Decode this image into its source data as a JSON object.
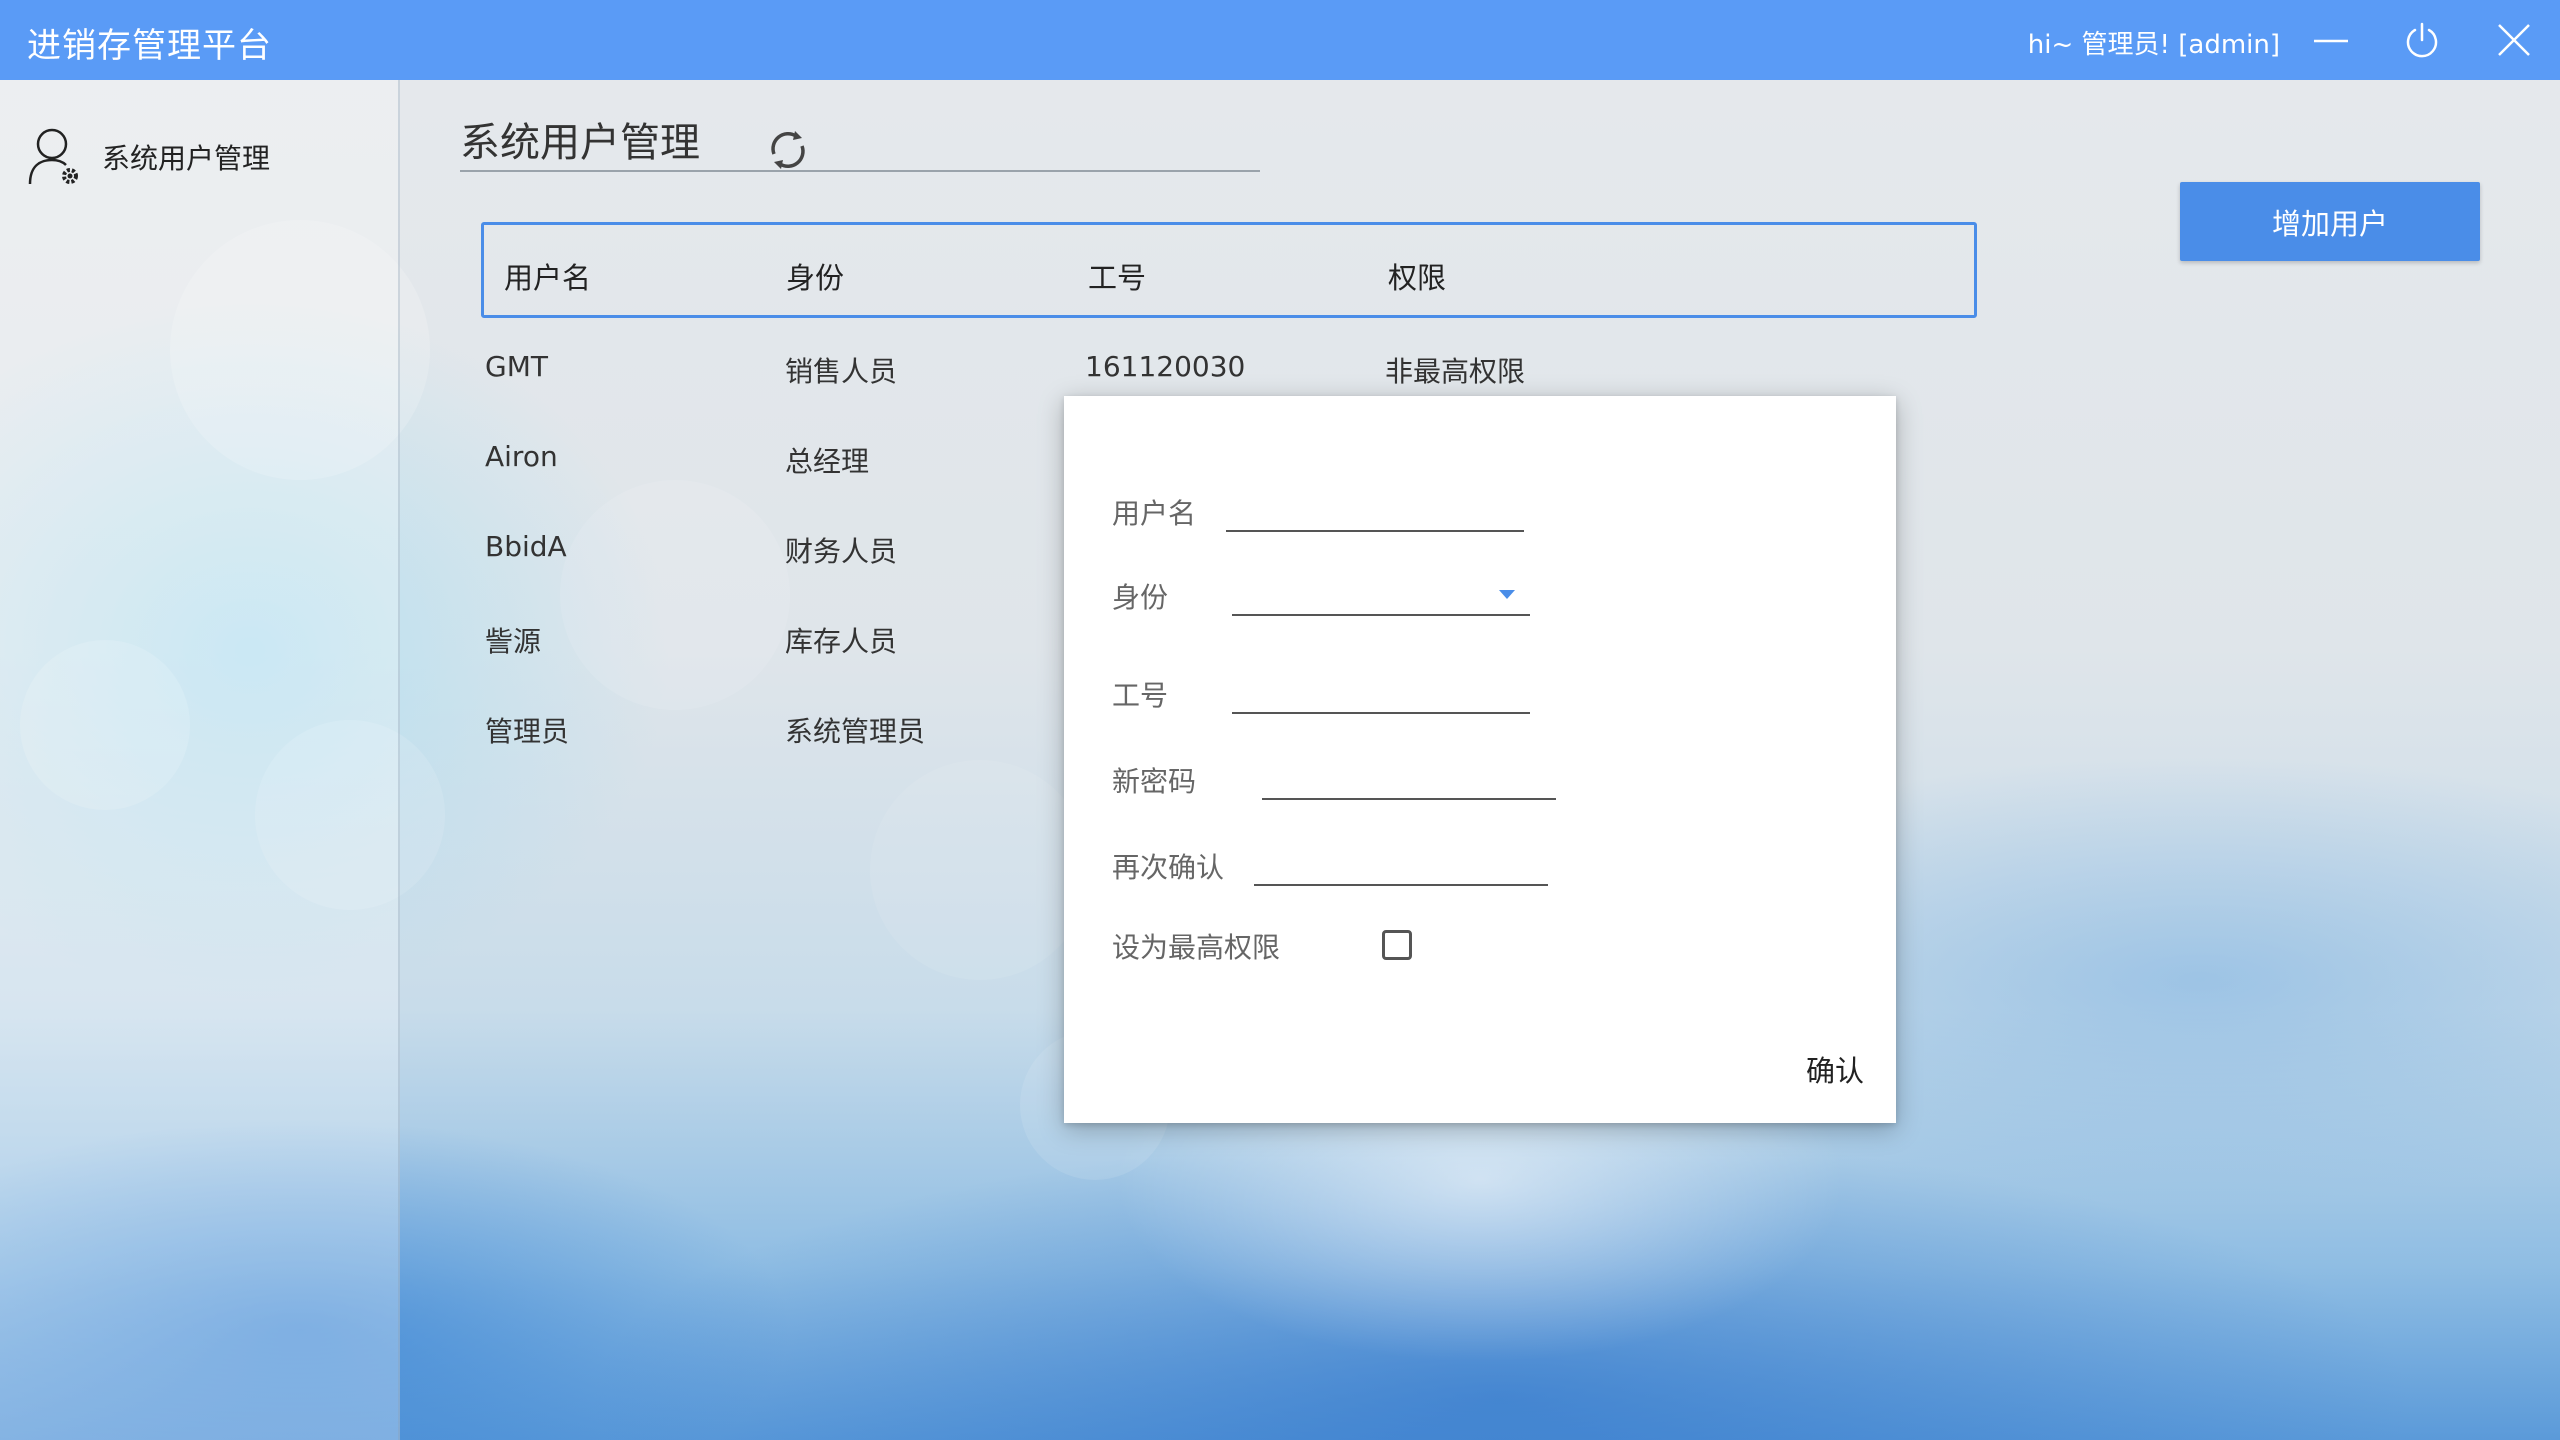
{
  "app": {
    "title": "进销存管理平台",
    "greeting": "hi~ 管理员! [admin]"
  },
  "titlebar_icons": [
    "minimize-icon",
    "power-icon",
    "close-icon"
  ],
  "sidebar": {
    "items": [
      {
        "label": "系统用户管理",
        "icon": "user-settings-icon"
      }
    ]
  },
  "main": {
    "title": "系统用户管理",
    "add_button_label": "增加用户",
    "table": {
      "headers": [
        "用户名",
        "身份",
        "工号",
        "权限"
      ],
      "rows": [
        [
          "GMT",
          "销售人员",
          "161120030",
          "非最高权限"
        ],
        [
          "Airon",
          "总经理",
          "",
          ""
        ],
        [
          "BbidA",
          "财务人员",
          "",
          ""
        ],
        [
          "訾源",
          "库存人员",
          "",
          ""
        ],
        [
          "管理员",
          "系统管理员",
          "",
          ""
        ]
      ]
    }
  },
  "dialog": {
    "fields": {
      "username_label": "用户名",
      "role_label": "身份",
      "id_label": "工号",
      "new_password_label": "新密码",
      "confirm_password_label": "再次确认",
      "superuser_label": "设为最高权限"
    },
    "values": {
      "username": "",
      "role": "",
      "id": "",
      "new_password": "",
      "confirm_password": ""
    },
    "superuser_checked": false,
    "confirm_label": "确认"
  },
  "colors": {
    "titlebar": "#5a9bf6",
    "accent": "#4a8de8"
  }
}
